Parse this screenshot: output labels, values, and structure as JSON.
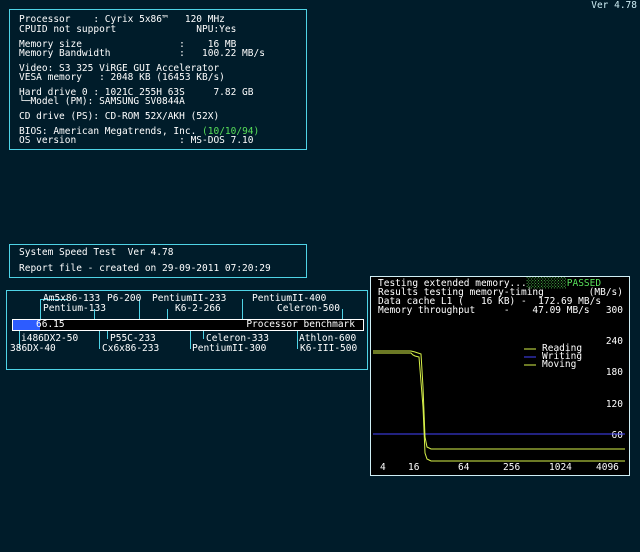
{
  "version": "Ver 4.78",
  "sysinfo": {
    "lines": [
      "Processor    : Cyrix 5x86™   120 MHz",
      "CPUID not support              NPU:Yes",
      "Memory size                 :    16 MB",
      "Memory Bandwidth            :   100.22 MB/s",
      "Video: S3 325 ViRGE GUI Accelerator",
      "VESA memory   : 2048 KB (16453 KB/s)",
      "Hard drive 0 : 1021C 255H 63S     7.82 GB",
      "└─Model (PM): SAMSUNG SV0844A",
      "CD drive (PS): CD-ROM 52X/AKH (52X)",
      "BIOS: American Megatrends, Inc. ",
      "OS version                  : MS-DOS 7.10"
    ],
    "bios_date": "(10/10/94)"
  },
  "speedtest": {
    "title": "System Speed Test  Ver 4.78",
    "report": "Report file - created on 29-09-2011 07:20:29"
  },
  "benchmark": {
    "top_row1": [
      "Am5x86-133",
      "P6-200",
      "PentiumII-233",
      "PentiumII-400"
    ],
    "top_row2": [
      "Pentium-133",
      "K6-2-266",
      "Celeron-500"
    ],
    "bottom_row1": [
      "i486DX2-50",
      "P55C-233",
      "Celeron-333",
      "Athlon-600"
    ],
    "bottom_row2": [
      "386DX-40",
      "Cx6x86-233",
      "PentiumII-300",
      "K6-III-500"
    ],
    "value": "66.15",
    "value_fraction": 0.077,
    "label": "Processor benchmark"
  },
  "memory": {
    "line1_text": "Testing extended memory...",
    "status": "PASSED",
    "line2_left": "Results testing memory-timing",
    "line2_right": "(MB/s)",
    "line3": "Data cache L1 (   16 KB) -  172.69 MB/s",
    "line4": "Memory throughput     -    47.09 MB/s",
    "legend": [
      "Reading",
      "Writing",
      "Moving"
    ],
    "y_ticks": [
      "300",
      "240",
      "180",
      "120",
      "60"
    ],
    "x_ticks": [
      "4",
      "16",
      "64",
      "256",
      "1024",
      "4096"
    ],
    "colors": {
      "reading": "#d8f24a",
      "writing": "#4545ff",
      "moving": "#d8f24a"
    }
  }
}
